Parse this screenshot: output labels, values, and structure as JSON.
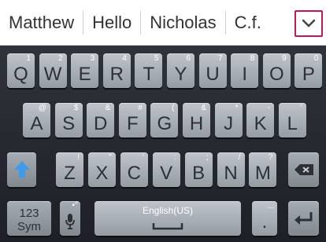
{
  "suggestions": [
    "Matthew",
    "Hello",
    "Nicholas",
    "C.f."
  ],
  "keyboard": {
    "rows": [
      [
        {
          "label": "Q",
          "sub": "1"
        },
        {
          "label": "W",
          "sub": "2"
        },
        {
          "label": "E",
          "sub": "3"
        },
        {
          "label": "R",
          "sub": "4"
        },
        {
          "label": "T",
          "sub": "5"
        },
        {
          "label": "Y",
          "sub": "6"
        },
        {
          "label": "U",
          "sub": "7"
        },
        {
          "label": "I",
          "sub": "8"
        },
        {
          "label": "O",
          "sub": "9"
        },
        {
          "label": "P",
          "sub": "0"
        }
      ],
      [
        {
          "label": "A",
          "sub": "@"
        },
        {
          "label": "S",
          "sub": "$"
        },
        {
          "label": "D",
          "sub": "&"
        },
        {
          "label": "F",
          "sub": "#"
        },
        {
          "label": "G",
          "sub": "("
        },
        {
          "label": "H",
          "sub": "&"
        },
        {
          "label": "J",
          "sub": "*"
        },
        {
          "label": "K",
          "sub": "-"
        },
        {
          "label": "L",
          "sub": "'"
        }
      ],
      [
        {
          "label": "Z",
          "sub": "!"
        },
        {
          "label": "X",
          "sub": "\""
        },
        {
          "label": "C",
          "sub": "'"
        },
        {
          "label": "V",
          "sub": ":"
        },
        {
          "label": "B",
          "sub": ";"
        },
        {
          "label": "N",
          "sub": "/"
        },
        {
          "label": "M",
          "sub": "?"
        }
      ]
    ],
    "sym_key": {
      "line1": "123",
      "line2": "Sym"
    },
    "space_label": "English(US)",
    "period_key": {
      "label": ".",
      "sub": "..."
    }
  },
  "icons": {
    "collapse": "chevron-down-icon",
    "shift": "shift-arrow-icon",
    "backspace": "backspace-icon",
    "mic": "microphone-icon",
    "enter": "enter-icon"
  },
  "colors": {
    "accent_border": "#c2185b",
    "shift_blue": "#3d9be9",
    "key_face": "#b4b9c0",
    "keyboard_bg": "#22262c"
  }
}
